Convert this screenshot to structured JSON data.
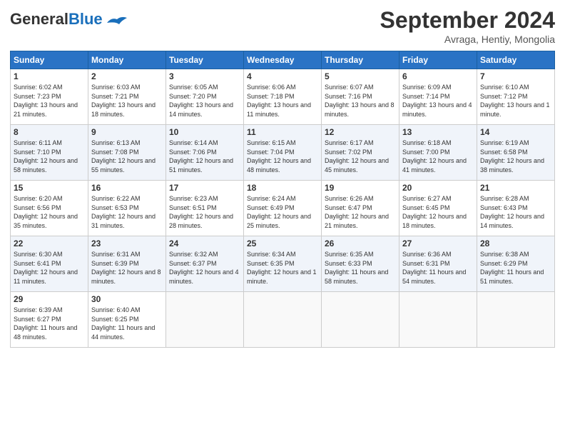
{
  "header": {
    "logo_line1": "General",
    "logo_line2": "Blue",
    "month_title": "September 2024",
    "location": "Avraga, Hentiy, Mongolia"
  },
  "weekdays": [
    "Sunday",
    "Monday",
    "Tuesday",
    "Wednesday",
    "Thursday",
    "Friday",
    "Saturday"
  ],
  "weeks": [
    [
      {
        "day": "1",
        "rise": "Sunrise: 6:02 AM",
        "set": "Sunset: 7:23 PM",
        "daylight": "Daylight: 13 hours and 21 minutes."
      },
      {
        "day": "2",
        "rise": "Sunrise: 6:03 AM",
        "set": "Sunset: 7:21 PM",
        "daylight": "Daylight: 13 hours and 18 minutes."
      },
      {
        "day": "3",
        "rise": "Sunrise: 6:05 AM",
        "set": "Sunset: 7:20 PM",
        "daylight": "Daylight: 13 hours and 14 minutes."
      },
      {
        "day": "4",
        "rise": "Sunrise: 6:06 AM",
        "set": "Sunset: 7:18 PM",
        "daylight": "Daylight: 13 hours and 11 minutes."
      },
      {
        "day": "5",
        "rise": "Sunrise: 6:07 AM",
        "set": "Sunset: 7:16 PM",
        "daylight": "Daylight: 13 hours and 8 minutes."
      },
      {
        "day": "6",
        "rise": "Sunrise: 6:09 AM",
        "set": "Sunset: 7:14 PM",
        "daylight": "Daylight: 13 hours and 4 minutes."
      },
      {
        "day": "7",
        "rise": "Sunrise: 6:10 AM",
        "set": "Sunset: 7:12 PM",
        "daylight": "Daylight: 13 hours and 1 minute."
      }
    ],
    [
      {
        "day": "8",
        "rise": "Sunrise: 6:11 AM",
        "set": "Sunset: 7:10 PM",
        "daylight": "Daylight: 12 hours and 58 minutes."
      },
      {
        "day": "9",
        "rise": "Sunrise: 6:13 AM",
        "set": "Sunset: 7:08 PM",
        "daylight": "Daylight: 12 hours and 55 minutes."
      },
      {
        "day": "10",
        "rise": "Sunrise: 6:14 AM",
        "set": "Sunset: 7:06 PM",
        "daylight": "Daylight: 12 hours and 51 minutes."
      },
      {
        "day": "11",
        "rise": "Sunrise: 6:15 AM",
        "set": "Sunset: 7:04 PM",
        "daylight": "Daylight: 12 hours and 48 minutes."
      },
      {
        "day": "12",
        "rise": "Sunrise: 6:17 AM",
        "set": "Sunset: 7:02 PM",
        "daylight": "Daylight: 12 hours and 45 minutes."
      },
      {
        "day": "13",
        "rise": "Sunrise: 6:18 AM",
        "set": "Sunset: 7:00 PM",
        "daylight": "Daylight: 12 hours and 41 minutes."
      },
      {
        "day": "14",
        "rise": "Sunrise: 6:19 AM",
        "set": "Sunset: 6:58 PM",
        "daylight": "Daylight: 12 hours and 38 minutes."
      }
    ],
    [
      {
        "day": "15",
        "rise": "Sunrise: 6:20 AM",
        "set": "Sunset: 6:56 PM",
        "daylight": "Daylight: 12 hours and 35 minutes."
      },
      {
        "day": "16",
        "rise": "Sunrise: 6:22 AM",
        "set": "Sunset: 6:53 PM",
        "daylight": "Daylight: 12 hours and 31 minutes."
      },
      {
        "day": "17",
        "rise": "Sunrise: 6:23 AM",
        "set": "Sunset: 6:51 PM",
        "daylight": "Daylight: 12 hours and 28 minutes."
      },
      {
        "day": "18",
        "rise": "Sunrise: 6:24 AM",
        "set": "Sunset: 6:49 PM",
        "daylight": "Daylight: 12 hours and 25 minutes."
      },
      {
        "day": "19",
        "rise": "Sunrise: 6:26 AM",
        "set": "Sunset: 6:47 PM",
        "daylight": "Daylight: 12 hours and 21 minutes."
      },
      {
        "day": "20",
        "rise": "Sunrise: 6:27 AM",
        "set": "Sunset: 6:45 PM",
        "daylight": "Daylight: 12 hours and 18 minutes."
      },
      {
        "day": "21",
        "rise": "Sunrise: 6:28 AM",
        "set": "Sunset: 6:43 PM",
        "daylight": "Daylight: 12 hours and 14 minutes."
      }
    ],
    [
      {
        "day": "22",
        "rise": "Sunrise: 6:30 AM",
        "set": "Sunset: 6:41 PM",
        "daylight": "Daylight: 12 hours and 11 minutes."
      },
      {
        "day": "23",
        "rise": "Sunrise: 6:31 AM",
        "set": "Sunset: 6:39 PM",
        "daylight": "Daylight: 12 hours and 8 minutes."
      },
      {
        "day": "24",
        "rise": "Sunrise: 6:32 AM",
        "set": "Sunset: 6:37 PM",
        "daylight": "Daylight: 12 hours and 4 minutes."
      },
      {
        "day": "25",
        "rise": "Sunrise: 6:34 AM",
        "set": "Sunset: 6:35 PM",
        "daylight": "Daylight: 12 hours and 1 minute."
      },
      {
        "day": "26",
        "rise": "Sunrise: 6:35 AM",
        "set": "Sunset: 6:33 PM",
        "daylight": "Daylight: 11 hours and 58 minutes."
      },
      {
        "day": "27",
        "rise": "Sunrise: 6:36 AM",
        "set": "Sunset: 6:31 PM",
        "daylight": "Daylight: 11 hours and 54 minutes."
      },
      {
        "day": "28",
        "rise": "Sunrise: 6:38 AM",
        "set": "Sunset: 6:29 PM",
        "daylight": "Daylight: 11 hours and 51 minutes."
      }
    ],
    [
      {
        "day": "29",
        "rise": "Sunrise: 6:39 AM",
        "set": "Sunset: 6:27 PM",
        "daylight": "Daylight: 11 hours and 48 minutes."
      },
      {
        "day": "30",
        "rise": "Sunrise: 6:40 AM",
        "set": "Sunset: 6:25 PM",
        "daylight": "Daylight: 11 hours and 44 minutes."
      },
      null,
      null,
      null,
      null,
      null
    ]
  ]
}
